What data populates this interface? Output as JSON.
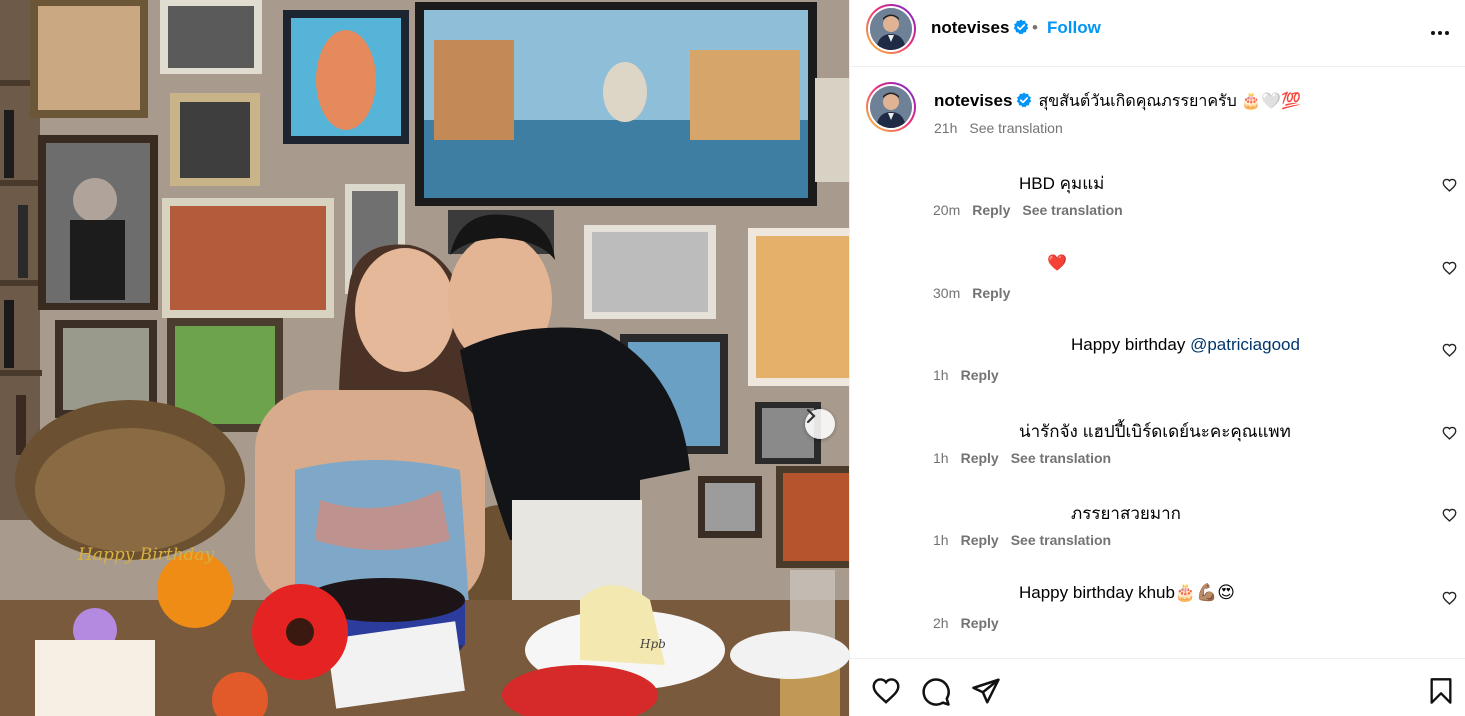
{
  "post": {
    "username": "notevises",
    "follow_label": "Follow",
    "separator": "•",
    "caption": "สุขสันต์วันเกิดคุณภรรยาครับ 🎂🤍💯",
    "caption_time": "21h",
    "see_translation": "See translation"
  },
  "comments": [
    {
      "text": "HBD คุมแม่",
      "time": "20m",
      "reply": "Reply",
      "translation": "See translation"
    },
    {
      "text": "❤️",
      "time": "30m",
      "reply": "Reply",
      "translation": ""
    },
    {
      "text": "Happy birthday ",
      "mention": "@patriciagood",
      "time": "1h",
      "reply": "Reply",
      "translation": ""
    },
    {
      "text": "น่ารักจัง แฮปปี้เบิร์ดเดย์นะคะคุณแพท",
      "time": "1h",
      "reply": "Reply",
      "translation": "See translation"
    },
    {
      "text": "ภรรยาสวยมาก",
      "time": "1h",
      "reply": "Reply",
      "translation": "See translation"
    },
    {
      "text": "Happy birthday khub🎂💪🏽😍",
      "time": "2h",
      "reply": "Reply",
      "translation": ""
    }
  ],
  "photo": {
    "cake_label": "Happy Birthday",
    "plate_label": "Hpb"
  },
  "icons": {
    "like": "heart-outline-icon",
    "comment": "comment-bubble-icon",
    "share": "paper-plane-icon",
    "save": "bookmark-icon",
    "more": "more-horizontal-icon",
    "next": "chevron-right-icon",
    "verified": "verified-badge-icon"
  },
  "colors": {
    "accent": "#0095f6",
    "verified": "#0095f6",
    "secondary_text": "#737373",
    "mention": "#00376b"
  }
}
